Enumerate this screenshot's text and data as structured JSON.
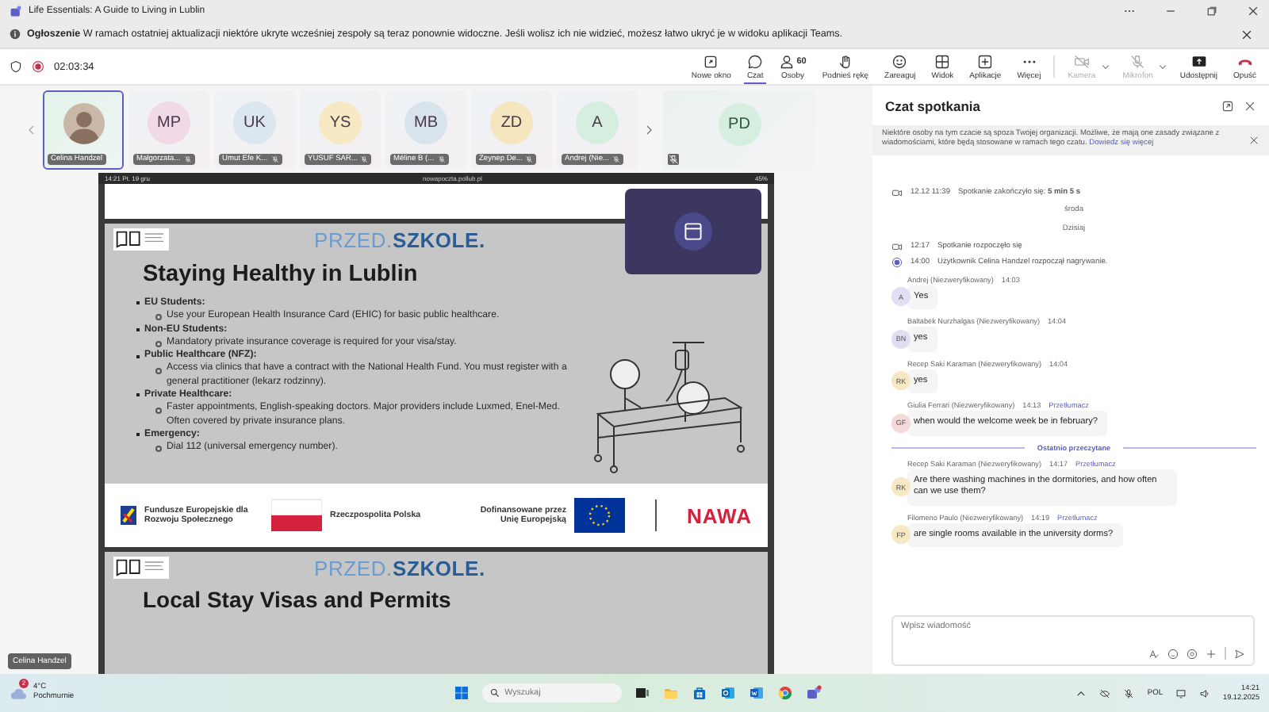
{
  "window": {
    "title": "Life Essentials: A Guide to Living in Lublin"
  },
  "announcement": {
    "label": "Ogłoszenie",
    "text": "W ramach ostatniej aktualizacji niektóre ukryte wcześniej zespoły są teraz ponownie widoczne. Jeśli wolisz ich nie widzieć, możesz łatwo ukryć je w widoku aplikacji Teams."
  },
  "meeting": {
    "timer": "02:03:34"
  },
  "toolbar": [
    {
      "kind": "window",
      "label": "Nowe okno",
      "selected": false,
      "disabled": false
    },
    {
      "kind": "chat",
      "label": "Czat",
      "selected": true,
      "disabled": false
    },
    {
      "kind": "people",
      "label": "Osoby",
      "badge": "60",
      "selected": false,
      "disabled": false
    },
    {
      "kind": "hand",
      "label": "Podnieś rękę",
      "selected": false,
      "disabled": false
    },
    {
      "kind": "emoji",
      "label": "Zareaguj",
      "selected": false,
      "disabled": false
    },
    {
      "kind": "grid",
      "label": "Widok",
      "selected": false,
      "disabled": false
    },
    {
      "kind": "apps",
      "label": "Aplikacje",
      "selected": false,
      "disabled": false
    },
    {
      "kind": "more",
      "label": "Więcej",
      "selected": false,
      "disabled": false
    },
    {
      "kind": "camera",
      "label": "Kamera",
      "selected": false,
      "disabled": true,
      "menu": true
    },
    {
      "kind": "mic",
      "label": "Mikrofon",
      "selected": false,
      "disabled": true,
      "menu": true
    },
    {
      "kind": "share",
      "label": "Udostępnij",
      "selected": false,
      "disabled": false
    },
    {
      "kind": "leave",
      "label": "Opuść",
      "selected": false,
      "disabled": false
    }
  ],
  "participants": [
    {
      "kind": "photo",
      "name": "Celina Handzel",
      "selected": true,
      "muted": false
    },
    {
      "kind": "initials",
      "initials": "MP",
      "name": "Małgorzata...",
      "color": "#f1d9e6",
      "selected": false,
      "muted": true
    },
    {
      "kind": "initials",
      "initials": "UK",
      "name": "Umut Efe K...",
      "color": "#dbe6ee",
      "selected": false,
      "muted": true
    },
    {
      "kind": "initials",
      "initials": "YS",
      "name": "YUSUF SAR...",
      "color": "#f7e9c4",
      "selected": false,
      "muted": true
    },
    {
      "kind": "initials",
      "initials": "MB",
      "name": "Méline B (...",
      "color": "#d9e3ec",
      "selected": false,
      "muted": true
    },
    {
      "kind": "initials",
      "initials": "ZD",
      "name": "Zeynep De...",
      "color": "#f6e6bf",
      "selected": false,
      "muted": true
    },
    {
      "kind": "initials",
      "initials": "A",
      "name": "Andrej (Nie...",
      "color": "#d6eedf",
      "selected": false,
      "muted": true
    }
  ],
  "stage_tile": {
    "initials": "PD",
    "color": "#d6eedf",
    "muted": true
  },
  "self_label": "Celina Handzel",
  "shared_screen": {
    "status_time": "14:21",
    "status_date": "Pt. 19 gru",
    "url": "nowapoczta.pollub.pl",
    "battery": "45%",
    "slide": {
      "brand_light": "PRZED.",
      "brand_bold": "SZKOLE.",
      "title": "Staying Healthy in Lublin",
      "bullets": [
        {
          "heading": "EU Students:",
          "items": [
            "Use your European Health Insurance Card (EHIC) for basic public healthcare."
          ]
        },
        {
          "heading": "Non-EU Students:",
          "items": [
            "Mandatory private insurance coverage is required for your visa/stay."
          ]
        },
        {
          "heading": "Public Healthcare (NFZ):",
          "items": [
            "Access via clinics that have a contract with the National Health Fund. You must register with a general practitioner (lekarz rodzinny)."
          ]
        },
        {
          "heading": "Private Healthcare:",
          "items": [
            "Faster appointments, English-speaking doctors. Major providers include Luxmed, Enel-Med. Often covered by private insurance plans."
          ]
        },
        {
          "heading": "Emergency:",
          "items": [
            "Dial 112 (universal emergency number)."
          ]
        }
      ],
      "footer": {
        "eu_funds": "Fundusze Europejskie dla Rozwoju Społecznego",
        "poland": "Rzeczpospolita Polska",
        "cofunded": "Dofinansowane przez Unię Europejską",
        "nawa": "NAWA"
      }
    },
    "next_slide": {
      "brand_light": "PRZED.",
      "brand_bold": "SZKOLE.",
      "title": "Local Stay Visas and Permits"
    }
  },
  "chat": {
    "title": "Czat spotkania",
    "notice": {
      "text": "Niektóre osoby na tym czacie są spoza Twojej organizacji. Możliwe, że mają one zasady związane z wiadomościami, które będą stosowane w ramach tego czatu.",
      "link": "Dowiedz się więcej"
    },
    "timeline": [
      {
        "kind": "meeting",
        "time": "12.12 11:39",
        "text": "Spotkanie zakończyło się: **5 min 5 s**"
      },
      {
        "kind": "day",
        "text": "środa"
      },
      {
        "kind": "day",
        "text": "Dzisiaj"
      },
      {
        "kind": "meeting",
        "time": "12:17",
        "text": "Spotkanie rozpoczęło się"
      },
      {
        "kind": "recording",
        "time": "14:00",
        "text": "Użytkownik Celina Handzel rozpoczął nagrywanie."
      },
      {
        "kind": "message",
        "author": "Andrej (Niezweryfikowany)",
        "time": "14:03",
        "initials": "A",
        "color": "#e1def3",
        "text": "Yes"
      },
      {
        "kind": "message",
        "author": "Baltabek Nurzhalgas (Niezweryfikowany)",
        "time": "14:04",
        "initials": "BN",
        "color": "#e1def3",
        "text": "yes"
      },
      {
        "kind": "message",
        "author": "Recep Saki Karaman (Niezweryfikowany)",
        "time": "14:04",
        "initials": "RK",
        "color": "#f6e8c3",
        "text": "yes"
      },
      {
        "kind": "message",
        "author": "Giulia Ferrari (Niezweryfikowany)",
        "time": "14:13",
        "translate": "Przetłumacz",
        "initials": "GF",
        "color": "#f4d7d9",
        "text": "when would the welcome week be in february?"
      },
      {
        "kind": "unread",
        "text": "Ostatnio przeczytane"
      },
      {
        "kind": "message",
        "author": "Recep Saki Karaman (Niezweryfikowany)",
        "time": "14:17",
        "translate": "Przetłumacz",
        "initials": "RK",
        "color": "#f6e8c3",
        "text": "Are there washing machines in the dormitories, and how often can we use them?"
      },
      {
        "kind": "message",
        "author": "Filomeno Paulo (Niezweryfikowany)",
        "time": "14:19",
        "translate": "Przetłumacz",
        "initials": "FP",
        "color": "#f6e8c3",
        "text": "are single rooms available in the university dorms?"
      }
    ],
    "input": {
      "placeholder": "Wpisz wiadomość"
    }
  },
  "taskbar": {
    "weather_badge": "2",
    "temperature": "4°C",
    "condition": "Pochmurnie",
    "search_placeholder": "Wyszukaj",
    "language": "POL",
    "time": "14:21",
    "date": "19.12.2025"
  }
}
